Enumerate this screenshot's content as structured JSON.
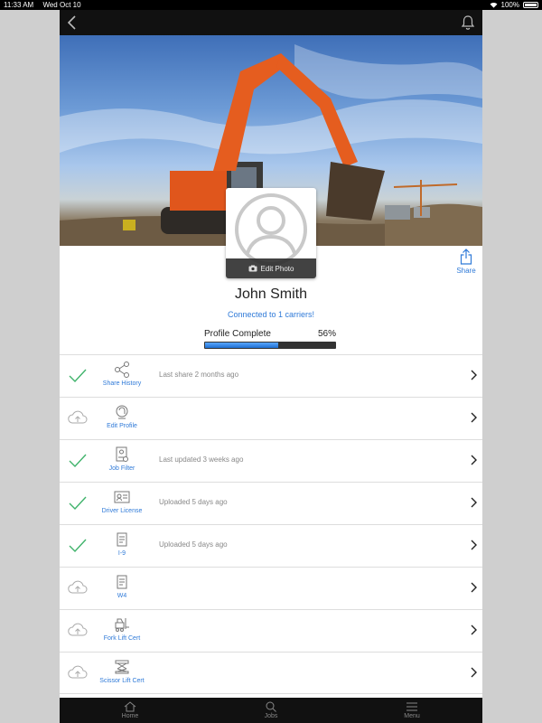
{
  "statusbar": {
    "time": "11:33 AM",
    "date": "Wed Oct 10",
    "battery": "100%"
  },
  "profile": {
    "name": "John Smith",
    "connected": "Connected to 1 carriers!",
    "edit_photo": "Edit Photo",
    "share": "Share",
    "progress_label": "Profile Complete",
    "progress_pct": "56%",
    "progress_value": 0.56
  },
  "rows": [
    {
      "status": "done",
      "icon": "share-history-icon",
      "label": "Share History",
      "detail": "Last share 2 months ago"
    },
    {
      "status": "upload",
      "icon": "edit-profile-icon",
      "label": "Edit Profile",
      "detail": ""
    },
    {
      "status": "done",
      "icon": "job-filter-icon",
      "label": "Job Filter",
      "detail": "Last updated 3 weeks ago"
    },
    {
      "status": "done",
      "icon": "driver-license-icon",
      "label": "Driver License",
      "detail": "Uploaded 5 days ago"
    },
    {
      "status": "done",
      "icon": "document-icon",
      "label": "I-9",
      "detail": "Uploaded 5 days ago"
    },
    {
      "status": "upload",
      "icon": "document-icon",
      "label": "W4",
      "detail": ""
    },
    {
      "status": "upload",
      "icon": "forklift-icon",
      "label": "Fork Lift Cert",
      "detail": ""
    },
    {
      "status": "upload",
      "icon": "scissor-lift-icon",
      "label": "Scissor Lift Cert",
      "detail": ""
    }
  ],
  "tabs": [
    {
      "label": "Home",
      "icon": "home-icon"
    },
    {
      "label": "Jobs",
      "icon": "search-icon"
    },
    {
      "label": "Menu",
      "icon": "menu-icon"
    }
  ]
}
